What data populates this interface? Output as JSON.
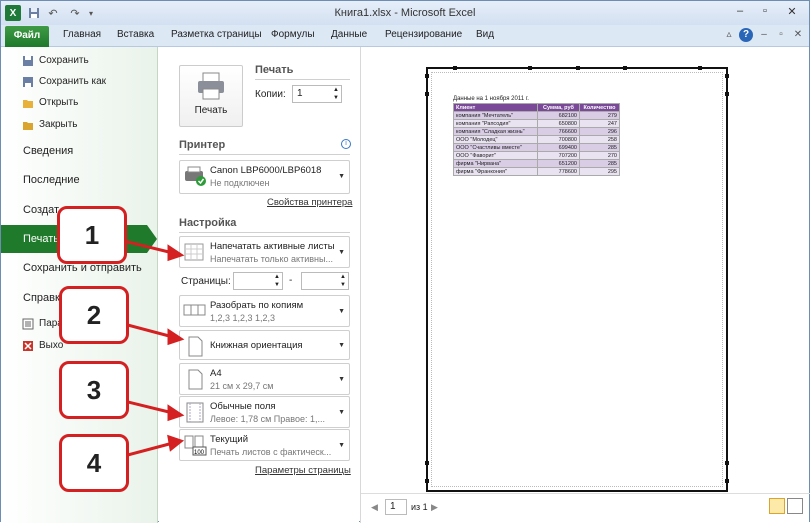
{
  "titlebar": {
    "title": "Книга1.xlsx  -  Microsoft Excel",
    "excel_icon": "X",
    "save_icon": "save-icon",
    "undo": "↶",
    "redo": "↷"
  },
  "ribbon_tabs": [
    "Файл",
    "Главная",
    "Вставка",
    "Разметка страницы",
    "Формулы",
    "Данные",
    "Рецензирование",
    "Вид"
  ],
  "backstage_menu": {
    "save": "Сохранить",
    "save_as": "Сохранить как",
    "open": "Открыть",
    "close": "Закрыть",
    "info": "Сведения",
    "recent": "Последние",
    "new": "Создат",
    "print": "Печать",
    "save_send": "Сохранить и отправить",
    "help": "Справка",
    "options": "Пара",
    "exit": "Выхо"
  },
  "print_section": {
    "header": "Печать",
    "button": "Печать",
    "copies_label": "Копии:",
    "copies_value": "1"
  },
  "printer": {
    "header": "Принтер",
    "name": "Canon LBP6000/LBP6018",
    "status": "Не подключен",
    "properties_link": "Свойства принтера",
    "info_icon": "i"
  },
  "settings": {
    "header": "Настройка",
    "what_title": "Напечатать активные листы",
    "what_sub": "Напечатать только активны...",
    "pages_label": "Страницы:",
    "pages_dash": "-",
    "collate_title": "Разобрать по копиям",
    "collate_sub": "1,2,3    1,2,3    1,2,3",
    "orientation": "Книжная ориентация",
    "paper_title": "A4",
    "paper_sub": "21 см x 29,7 см",
    "margins_title": "Обычные поля",
    "margins_sub": "Левое: 1,78 см    Правое: 1,...",
    "scale_title": "Текущий",
    "scale_sub": "Печать листов с фактическ...",
    "scale_icon_text": "100",
    "page_setup_link": "Параметры страницы"
  },
  "preview": {
    "caption": "Данные на 1 ноября 2011 г.",
    "headers": [
      "Клиент",
      "Сумма, руб",
      "Количество"
    ],
    "rows": [
      [
        "компания \"Мечтатель\"",
        "682100",
        "279"
      ],
      [
        "компания \"Рапсодия\"",
        "650800",
        "247"
      ],
      [
        "компания \"Сладкая жизнь\"",
        "766600",
        "296"
      ],
      [
        "ООО \"Молодец\"",
        "700800",
        "258"
      ],
      [
        "ООО \"Счастливы вместе\"",
        "699400",
        "285"
      ],
      [
        "ООО \"Фаворит\"",
        "707200",
        "270"
      ],
      [
        "фирма \"Нирвана\"",
        "651200",
        "285"
      ],
      [
        "фирма \"Франкония\"",
        "778600",
        "295"
      ]
    ],
    "page_current": "1",
    "page_of": "из 1"
  },
  "callouts": [
    "1",
    "2",
    "3",
    "4"
  ],
  "colors": {
    "file_tab": "#1e7a2b",
    "callout_border": "#d42020",
    "table_header": "#7a4a98"
  }
}
